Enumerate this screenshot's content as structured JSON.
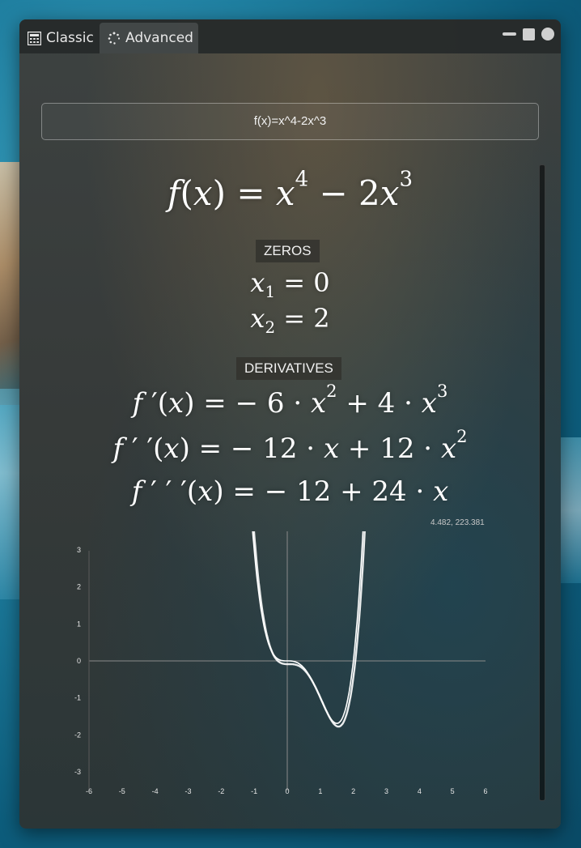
{
  "tabs": [
    {
      "label": "Classic",
      "icon": "calculator-icon",
      "active": false
    },
    {
      "label": "Advanced",
      "icon": "spinner-dots-icon",
      "active": true
    }
  ],
  "window_controls": [
    "minimize-icon",
    "maximize-icon",
    "close-icon"
  ],
  "input": {
    "value": "f(x)=x^4-2x^3"
  },
  "sections": {
    "zeros": "ZEROS",
    "derivatives": "DERIVATIVES"
  },
  "zeros": [
    {
      "name": "x",
      "index": "1",
      "value": "0"
    },
    {
      "name": "x",
      "index": "2",
      "value": "2"
    }
  ],
  "derivative_terms": {
    "d1": {
      "coef1": "6",
      "exp1": "2",
      "coef2": "4",
      "exp2": "3"
    },
    "d2": {
      "coef1": "12",
      "coef2": "12",
      "exp2": "2"
    },
    "d3": {
      "coef1": "12",
      "coef2": "24"
    }
  },
  "function_exponents": {
    "e1": "4",
    "coef": "2",
    "e2": "3"
  },
  "plot": {
    "coordinate_readout": "4.482, 223.381",
    "x_ticks": [
      "-6",
      "-5",
      "-4",
      "-3",
      "-2",
      "-1",
      "0",
      "1",
      "2",
      "3",
      "4",
      "5",
      "6"
    ],
    "y_ticks": [
      "3",
      "2",
      "1",
      "0",
      "-1",
      "-2",
      "-3"
    ],
    "xlim": [
      -6,
      6
    ],
    "ylim": [
      -3.5,
      3.5
    ],
    "curve_color": "#ffffff",
    "axis_color": "#8a8a8a"
  },
  "chart_data": {
    "type": "line",
    "series": [
      {
        "expression": "x^4-2x^3",
        "x": [
          -1.0,
          -0.8,
          -0.6,
          -0.4,
          -0.2,
          0.0,
          0.2,
          0.4,
          0.6,
          0.8,
          1.0,
          1.2,
          1.4,
          1.5,
          1.6,
          1.8,
          2.0,
          2.2,
          2.3
        ],
        "y": [
          3.0,
          1.43,
          0.56,
          0.15,
          0.018,
          0.0,
          -0.014,
          -0.102,
          -0.302,
          -0.614,
          -1.0,
          -1.382,
          -1.646,
          -1.688,
          -1.638,
          -1.166,
          0.0,
          2.1,
          3.58
        ]
      }
    ],
    "xlim": [
      -6,
      6
    ],
    "ylim": [
      -3.5,
      3.5
    ],
    "x_ticks": [
      -6,
      -5,
      -4,
      -3,
      -2,
      -1,
      0,
      1,
      2,
      3,
      4,
      5,
      6
    ],
    "y_ticks": [
      -3,
      -2,
      -1,
      0,
      1,
      2,
      3
    ],
    "grid": false
  }
}
